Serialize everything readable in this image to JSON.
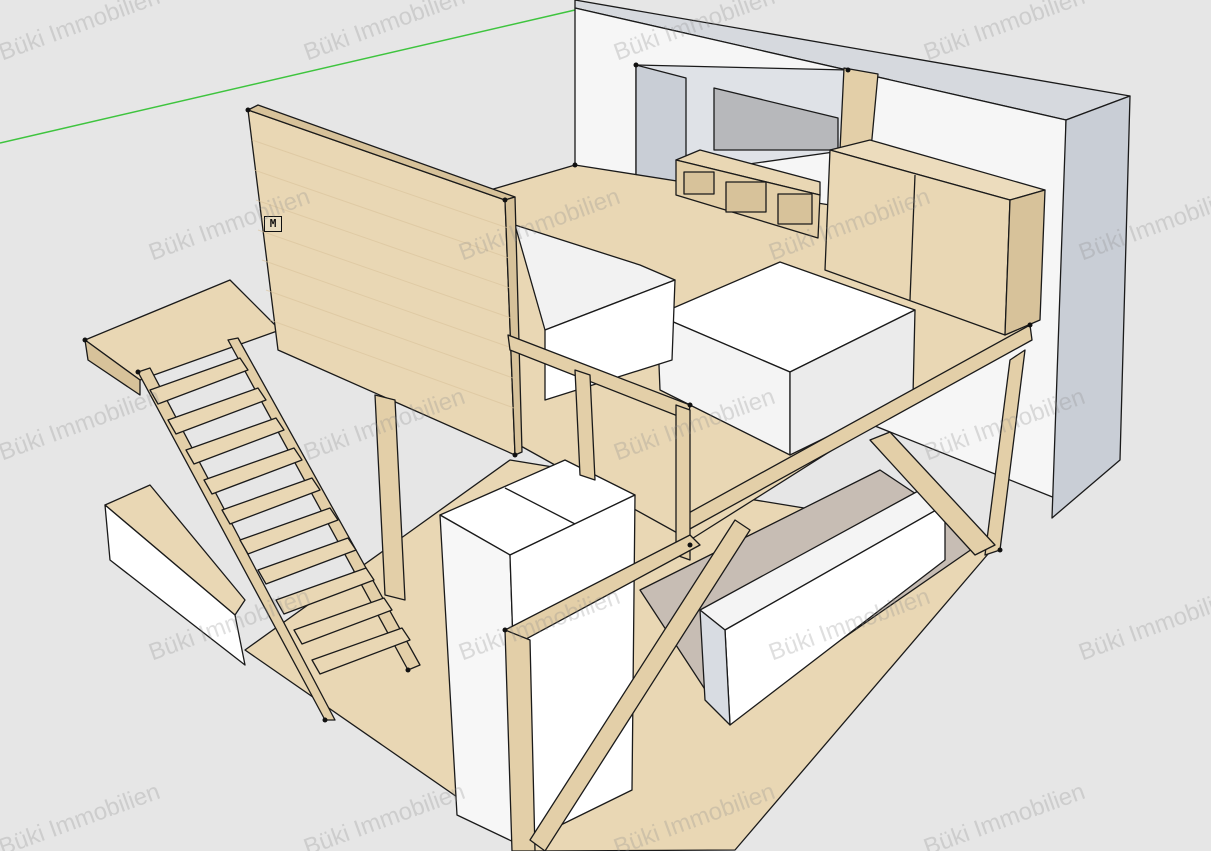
{
  "viewport": {
    "background": "#e6e6e6",
    "axis_color": "#3ec43e"
  },
  "model": {
    "wood_color": "#e9d7b4",
    "wood_dark": "#d7c29a",
    "wall_color": "#f6f6f6",
    "wall_shadow": "#c9ced6",
    "carpet_color": "#c7bdb4",
    "edge_color": "#1a1a1a",
    "wall_badge": "M"
  },
  "watermark": {
    "text": "Büki Immobilien"
  }
}
